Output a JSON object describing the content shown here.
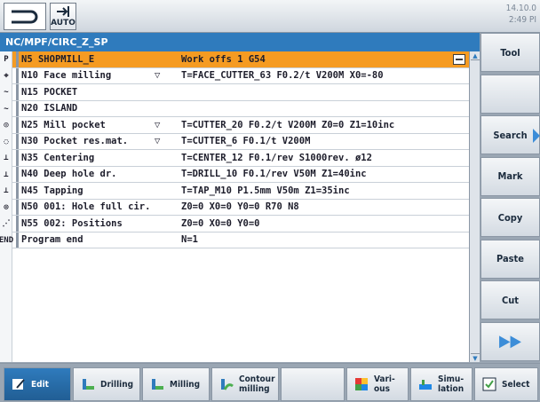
{
  "header": {
    "mode_label": "AUTO",
    "date": "14.10.0",
    "time": "2:49 PI"
  },
  "program": {
    "title": "NC/MPF/CIRC_Z_SP",
    "rows": [
      {
        "icon": "P",
        "icon_name": "program-header-icon",
        "block": "N5",
        "name": "SHOPMILL_E",
        "flag": "",
        "params": "Work offs 1 G54",
        "selected": true
      },
      {
        "icon": "⌖",
        "icon_name": "face-milling-icon",
        "block": "N10",
        "name": "Face milling",
        "flag": "▽",
        "params": "T=FACE_CUTTER_63 F0.2/t V200M X0=-80",
        "selected": false
      },
      {
        "icon": "∼",
        "icon_name": "contour-icon",
        "block": "N15",
        "name": "POCKET",
        "flag": "",
        "params": "",
        "selected": false
      },
      {
        "icon": "∼",
        "icon_name": "contour-icon",
        "block": "N20",
        "name": "ISLAND",
        "flag": "",
        "params": "",
        "selected": false
      },
      {
        "icon": "◎",
        "icon_name": "mill-pocket-icon",
        "block": "N25",
        "name": "Mill pocket",
        "flag": "▽",
        "params": "T=CUTTER_20 F0.2/t V200M Z0=0 Z1=10inc",
        "selected": false
      },
      {
        "icon": "◌",
        "icon_name": "pocket-residual-icon",
        "block": "N30",
        "name": "Pocket res.mat.",
        "flag": "▽",
        "params": "T=CUTTER_6 F0.1/t V200M",
        "selected": false
      },
      {
        "icon": "⊥",
        "icon_name": "centering-icon",
        "block": "N35",
        "name": "Centering",
        "flag": "",
        "params": "T=CENTER_12 F0.1/rev S1000rev. ø12",
        "selected": false
      },
      {
        "icon": "⊥",
        "icon_name": "deep-hole-drill-icon",
        "block": "N40",
        "name": "Deep hole dr.",
        "flag": "",
        "params": "T=DRILL_10 F0.1/rev V50M Z1=40inc",
        "selected": false
      },
      {
        "icon": "⊥",
        "icon_name": "tapping-icon",
        "block": "N45",
        "name": "Tapping",
        "flag": "",
        "params": "T=TAP_M10 P1.5mm V50m Z1=35inc",
        "selected": false
      },
      {
        "icon": "⊙",
        "icon_name": "hole-full-circle-icon",
        "block": "N50",
        "name": "001: Hole full cir.",
        "flag": "",
        "params": "Z0=0 X0=0 Y0=0 R70 N8",
        "selected": false
      },
      {
        "icon": "⋰",
        "icon_name": "positions-icon",
        "block": "N55",
        "name": "002: Positions",
        "flag": "",
        "params": "Z0=0 X0=0 Y0=0",
        "selected": false
      },
      {
        "icon": "END",
        "icon_name": "end-icon",
        "block": "",
        "name": "Program end",
        "flag": "",
        "params": "N=1",
        "selected": false
      }
    ]
  },
  "softkeys": {
    "tool": "Tool",
    "search": "Search",
    "mark": "Mark",
    "copy": "Copy",
    "paste": "Paste",
    "cut": "Cut",
    "more": "▶▶"
  },
  "bottom": {
    "edit": "Edit",
    "drilling": "Drilling",
    "milling": "Milling",
    "contour": "Contour milling",
    "various": "Vari-ous",
    "simulation": "Simu-lation",
    "select": "Select"
  },
  "colors": {
    "title_bg": "#2f7bbd",
    "selection": "#f59b22",
    "accent": "#3c8dd8"
  }
}
